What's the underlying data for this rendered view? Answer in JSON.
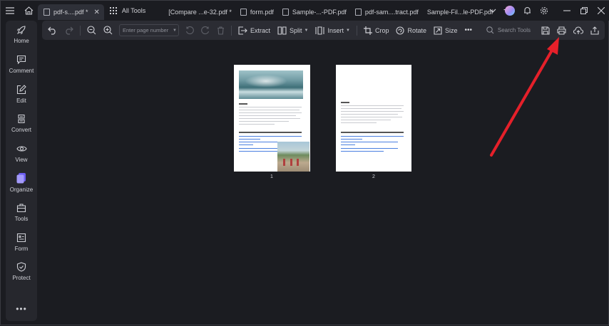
{
  "titlebar": {
    "tabs": [
      {
        "label": "pdf-s....pdf *",
        "active": true
      },
      {
        "label": "[Compare ...e-32.pdf *",
        "active": false
      },
      {
        "label": "form.pdf",
        "active": false
      },
      {
        "label": "Sample-...-PDF.pdf",
        "active": false
      },
      {
        "label": "pdf-sam....tract.pdf",
        "active": false
      },
      {
        "label": "Sample-Fil...le-PDF.pdf",
        "active": false
      }
    ],
    "all_tools_label": "All Tools"
  },
  "sidebar": {
    "items": [
      {
        "label": "Home",
        "icon": "rocket-icon"
      },
      {
        "label": "Comment",
        "icon": "comment-icon"
      },
      {
        "label": "Edit",
        "icon": "edit-icon"
      },
      {
        "label": "Convert",
        "icon": "convert-icon"
      },
      {
        "label": "View",
        "icon": "eye-icon"
      },
      {
        "label": "Organize",
        "icon": "organize-icon"
      },
      {
        "label": "Tools",
        "icon": "toolbox-icon"
      },
      {
        "label": "Form",
        "icon": "form-icon"
      },
      {
        "label": "Protect",
        "icon": "shield-icon"
      }
    ],
    "more": "•••"
  },
  "toolbar": {
    "page_placeholder": "Enter page number",
    "extract": "Extract",
    "split": "Split",
    "insert": "Insert",
    "crop": "Crop",
    "rotate": "Rotate",
    "size": "Size",
    "more": "•••",
    "search_tools": "Search Tools"
  },
  "pages": [
    {
      "number": "1"
    },
    {
      "number": "2"
    }
  ],
  "colors": {
    "accent_active": "#8b7cf6",
    "annotation_arrow": "#e5202a",
    "background": "#1b1c21"
  }
}
